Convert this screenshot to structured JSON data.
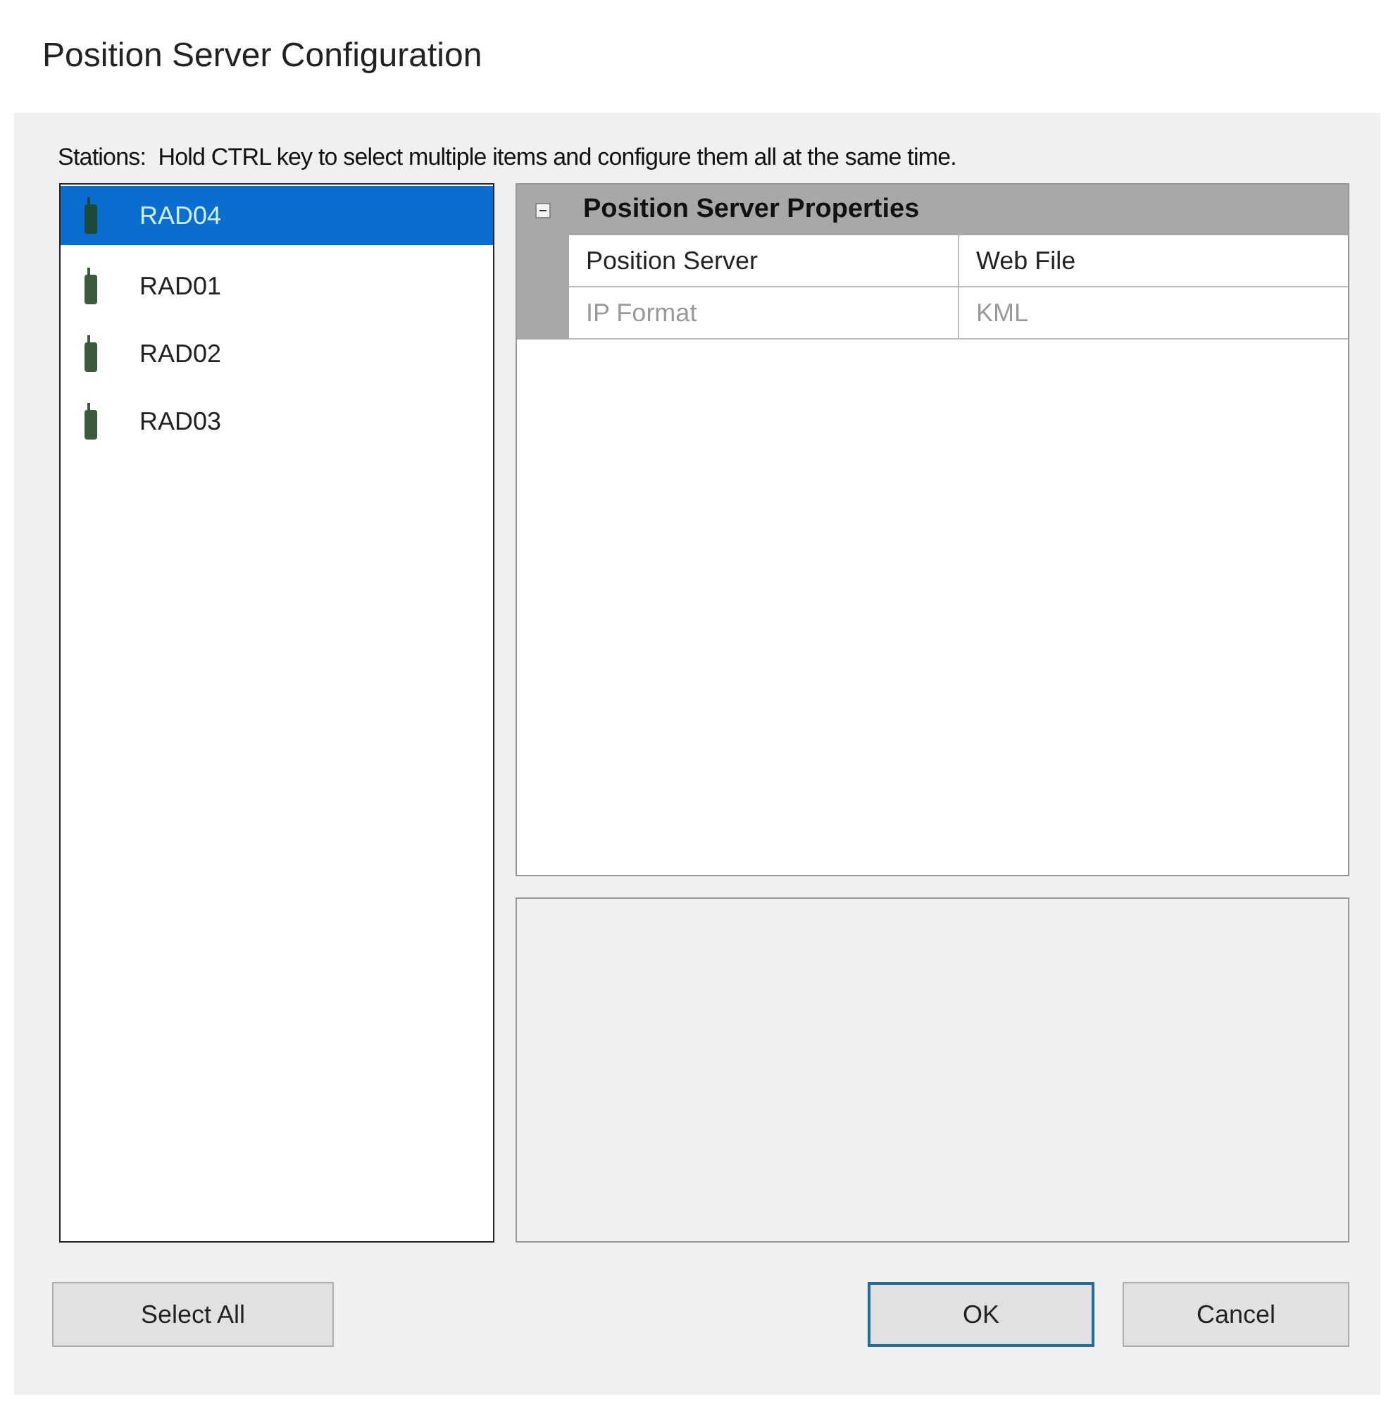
{
  "window": {
    "title": "Position Server Configuration"
  },
  "stations_hint": "Stations:  Hold CTRL key to select multiple items and configure them all at the same time.",
  "stations": [
    {
      "label": "RAD04",
      "selected": true
    },
    {
      "label": "RAD01",
      "selected": false
    },
    {
      "label": "RAD02",
      "selected": false
    },
    {
      "label": "RAD03",
      "selected": false
    }
  ],
  "property_grid": {
    "category": {
      "title": "Position Server Properties",
      "expanded": true
    },
    "rows": [
      {
        "name": "Position Server",
        "value": "Web File",
        "disabled": false
      },
      {
        "name": "IP Format",
        "value": "KML",
        "disabled": true
      }
    ]
  },
  "buttons_left": [
    {
      "label": "Select All",
      "default": false
    }
  ],
  "buttons_right": [
    {
      "label": "OK",
      "default": true
    },
    {
      "label": "Cancel",
      "default": false
    }
  ]
}
